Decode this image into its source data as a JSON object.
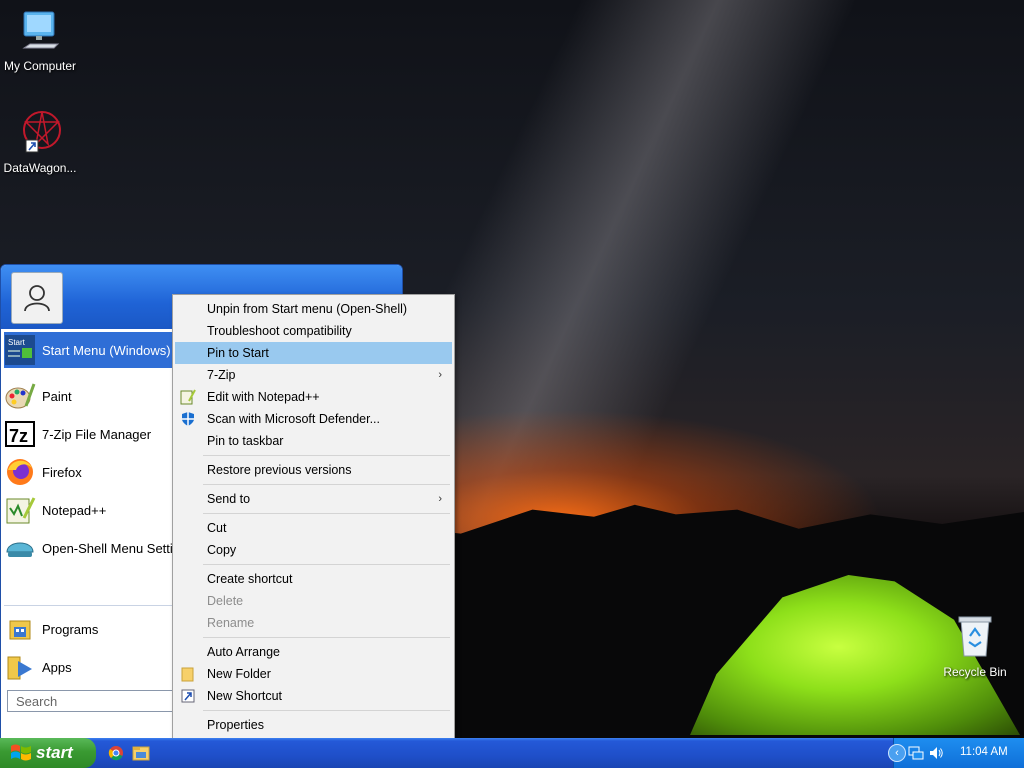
{
  "desktop": {
    "icons": [
      {
        "label": "My Computer"
      },
      {
        "label": "DataWagon..."
      },
      {
        "label": "Recycle Bin"
      }
    ]
  },
  "start_menu": {
    "pinned": [
      {
        "label": "Start Menu (Windows)",
        "icon": "start-menu-icon"
      },
      {
        "label": "Paint",
        "icon": "paint-icon"
      },
      {
        "label": "7-Zip File Manager",
        "icon": "7zip-icon"
      },
      {
        "label": "Firefox",
        "icon": "firefox-icon"
      },
      {
        "label": "Notepad++",
        "icon": "notepadpp-icon"
      },
      {
        "label": "Open-Shell Menu Setti",
        "icon": "openshell-icon"
      }
    ],
    "programs_label": "Programs",
    "apps_label": "Apps",
    "search_placeholder": "Search"
  },
  "context_menu": {
    "items": [
      {
        "label": "Unpin from Start menu (Open-Shell)"
      },
      {
        "label": "Troubleshoot compatibility"
      },
      {
        "label": "Pin to Start"
      },
      {
        "label": "7-Zip"
      },
      {
        "label": "Edit with Notepad++"
      },
      {
        "label": "Scan with Microsoft Defender..."
      },
      {
        "label": "Pin to taskbar"
      },
      {
        "label": "Restore previous versions"
      },
      {
        "label": "Send to"
      },
      {
        "label": "Cut"
      },
      {
        "label": "Copy"
      },
      {
        "label": "Create shortcut"
      },
      {
        "label": "Delete"
      },
      {
        "label": "Rename"
      },
      {
        "label": "Auto Arrange"
      },
      {
        "label": "New Folder"
      },
      {
        "label": "New Shortcut"
      },
      {
        "label": "Properties"
      }
    ],
    "highlighted": "Pin to Start",
    "disabled": [
      "Delete",
      "Rename"
    ]
  },
  "taskbar": {
    "start_label": "start",
    "clock": "11:04 AM"
  },
  "colors": {
    "taskbar_blue": "#2459d8",
    "start_green": "#3a9a32",
    "menu_highlight": "#99c9ef",
    "selected_item": "#2f6ed6"
  }
}
